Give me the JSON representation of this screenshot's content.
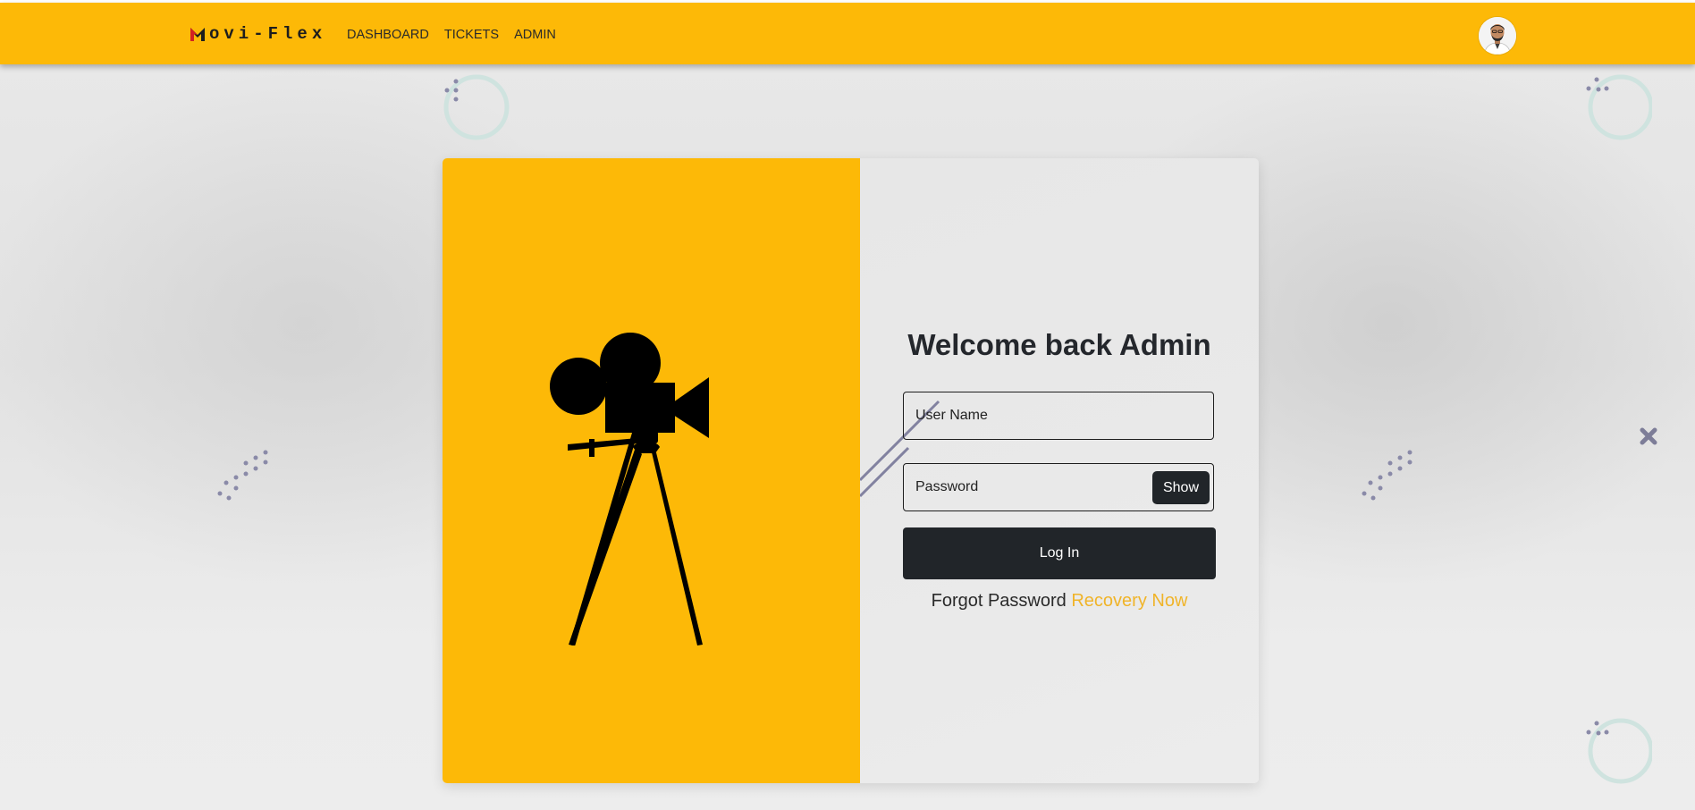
{
  "navbar": {
    "brand": "ovi-Flex",
    "links": [
      "DASHBOARD",
      "TICKETS",
      "ADMIN"
    ],
    "avatar_icon": "user-avatar",
    "color": "#fdb907"
  },
  "login": {
    "title": "Welcome back Admin",
    "username_placeholder": "User Name",
    "password_placeholder": "Password",
    "show_label": "Show",
    "login_label": "Log In",
    "forgot_text": "Forgot Password",
    "recovery_link": "Recovery Now"
  },
  "illustration": {
    "icon": "movie-camera-tripod-icon"
  },
  "theme": {
    "accent": "#fdb907",
    "dark_button": "#212529",
    "link_color": "#f0b429"
  }
}
